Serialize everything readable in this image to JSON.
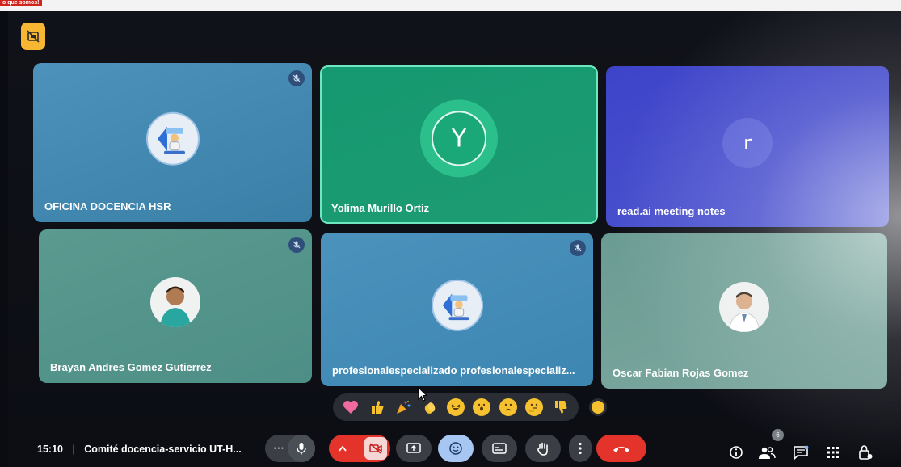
{
  "banner": {
    "text": "o que somos!"
  },
  "tiles": [
    {
      "name": "OFICINA DOCENCIA HSR",
      "muted": true
    },
    {
      "name": "Yolima Murillo Ortiz",
      "initial": "Y",
      "speaking": true
    },
    {
      "name": "read.ai meeting notes",
      "initial": "r"
    },
    {
      "name": "Brayan Andres Gomez Gutierrez",
      "muted": true
    },
    {
      "name": "profesionalespecializado profesionalespecializ...",
      "muted": true
    },
    {
      "name": "Oscar Fabian Rojas Gomez"
    }
  ],
  "reactions": [
    "heart",
    "thumbs-up",
    "party-popper",
    "clapping-hands",
    "laughing",
    "surprised",
    "sad",
    "thinking",
    "thumbs-down"
  ],
  "bottom_bar": {
    "time": "15:10",
    "separator": "|",
    "meeting_title": "Comité docencia-servicio UT-H...",
    "people_count": "6"
  },
  "colors": {
    "tile_blue": "#3f86b0",
    "tile_green": "#1a9a6f",
    "tile_indigo": "#3b44c6",
    "tile_teal": "#5a8f8a",
    "end_call": "#e3332a",
    "reaction_active": "#a7c7f2",
    "top_button": "#f7b733"
  }
}
